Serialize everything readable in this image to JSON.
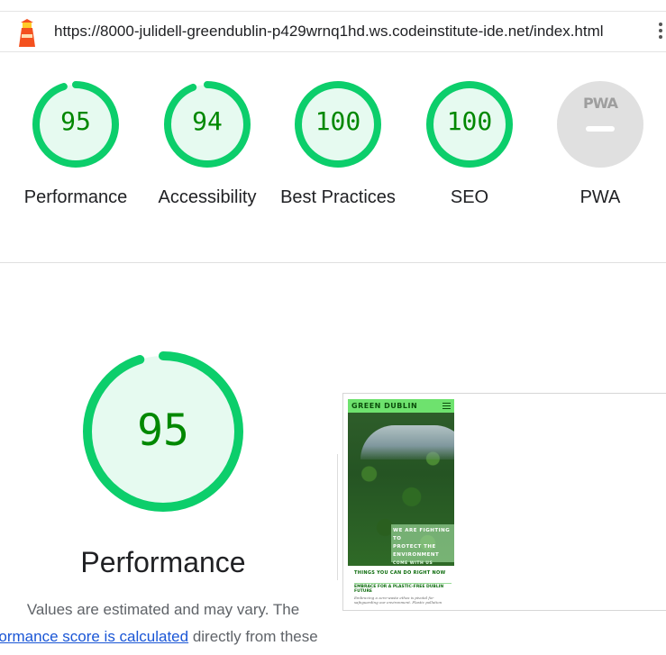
{
  "browser": {
    "url": "https://8000-julidell-greendublin-p429wrnq1hd.ws.codeinstitute-ide.net/index.html"
  },
  "scores": [
    {
      "label": "Performance",
      "value": "95",
      "fraction": 0.95,
      "color": "#0cce6b"
    },
    {
      "label": "Accessibility",
      "value": "94",
      "fraction": 0.94,
      "color": "#0cce6b"
    },
    {
      "label": "Best Practices",
      "value": "100",
      "fraction": 1.0,
      "color": "#0cce6b"
    },
    {
      "label": "SEO",
      "value": "100",
      "fraction": 1.0,
      "color": "#0cce6b"
    },
    {
      "label": "PWA",
      "value": "",
      "fraction": 0,
      "color": "#e0e0e0",
      "badge_text": "PWA"
    }
  ],
  "performance": {
    "score": "95",
    "fraction": 0.95,
    "title": "Performance",
    "description_line1": "Values are estimated and may vary. The",
    "link_text": "rformance score is calculated",
    "description_line2_suffix": " directly from these"
  },
  "screenshot": {
    "brand": "GREEN DUBLIN",
    "hero_line1": "WE ARE FIGHTING TO",
    "hero_line2": "PROTECT THE",
    "hero_line3": "ENVIRONMENT",
    "hero_sub": "COME WITH US",
    "section_heading": "THINGS YOU CAN DO RIGHT NOW",
    "card_heading": "EMBRACE FOR A PLASTIC-FREE DUBLIN FUTURE",
    "card_text": "Embracing a zero-waste ethos is pivotal for safeguarding our environment. Plastic pollution"
  },
  "colors": {
    "pass_green": "#0cce6b",
    "pass_fill": "#e6faf0",
    "pass_text": "#008800",
    "pwa_gray": "#e0e0e0"
  }
}
